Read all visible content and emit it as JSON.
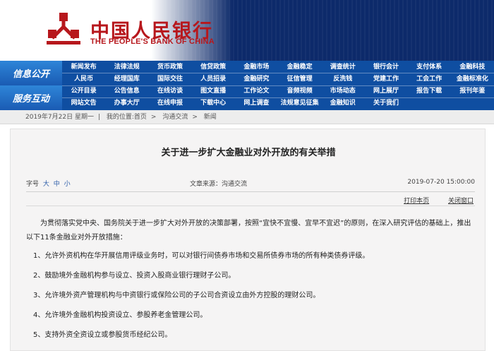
{
  "header": {
    "logo_cn": "中国人民银行",
    "logo_en": "THE PEOPLE'S BANK OF CHINA",
    "brand_color": "#b7171c"
  },
  "nav": {
    "section1": "信息公开",
    "section2": "服务互动",
    "rows": [
      [
        "新闻发布",
        "法律法规",
        "货币政策",
        "信贷政策",
        "金融市场",
        "金融稳定",
        "调查统计",
        "银行会计",
        "支付体系",
        "金融科技"
      ],
      [
        "人民币",
        "经理国库",
        "国际交往",
        "人员招录",
        "金融研究",
        "征信管理",
        "反洗钱",
        "党建工作",
        "工会工作",
        "金融标准化"
      ],
      [
        "公开目录",
        "公告信息",
        "在线访谈",
        "图文直播",
        "工作论文",
        "音频视频",
        "市场动态",
        "网上展厅",
        "报告下载",
        "报刊年鉴"
      ],
      [
        "网站文告",
        "办事大厅",
        "在线申报",
        "下载中心",
        "网上调查",
        "法规意见征集",
        "金融知识",
        "关于我们",
        "",
        ""
      ]
    ]
  },
  "breadcrumb": {
    "date": "2019年7月22日 星期一",
    "location_label": "我的位置:首页",
    "path": [
      "沟通交流",
      "新闻"
    ]
  },
  "article": {
    "title": "关于进一步扩大金融业对外开放的有关举措",
    "font_label": "字号",
    "font_sizes": [
      "大",
      "中",
      "小"
    ],
    "source": "文章来源：沟通交流",
    "datetime": "2019-07-20 15:00:00",
    "print_label": "打印本页",
    "close_label": "关闭窗口",
    "intro": "为贯彻落实党中央、国务院关于进一步扩大对外开放的决策部署，按照“宜快不宜慢、宜早不宜迟”的原则，在深入研究评估的基础上，推出以下11条金融业对外开放措施：",
    "items": [
      "1、允许外资机构在华开展信用评级业务时，可以对银行间债券市场和交易所债券市场的所有种类债券评级。",
      "2、鼓励境外金融机构参与设立、投资入股商业银行理财子公司。",
      "3、允许境外资产管理机构与中资银行或保险公司的子公司合资设立由外方控股的理财公司。",
      "4、允许境外金融机构投资设立、参股养老金管理公司。",
      "5、支持外资全资设立或参股货币经纪公司。"
    ]
  }
}
